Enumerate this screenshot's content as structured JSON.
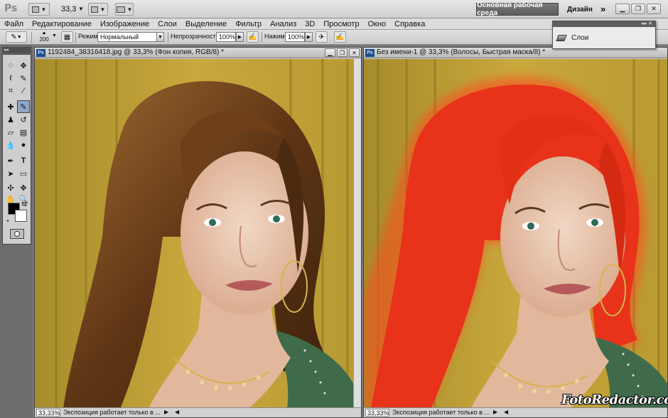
{
  "app": {
    "logo": "Ps",
    "zoom": "33,3",
    "workspace": "Основная рабочая среда",
    "design": "Дизайн",
    "more": "»"
  },
  "menu": [
    "Файл",
    "Редактирование",
    "Изображение",
    "Слои",
    "Выделение",
    "Фильтр",
    "Анализ",
    "3D",
    "Просмотр",
    "Окно",
    "Справка"
  ],
  "options": {
    "brush_size": "200",
    "mode_label": "Режим:",
    "mode_value": "Нормальный",
    "opacity_label": "Непрозрачность:",
    "opacity_value": "100%",
    "flow_label": "Нажим:",
    "flow_value": "100%"
  },
  "layers_panel": {
    "label": "Слои"
  },
  "documents": [
    {
      "badge": "Ps",
      "title": "1192484_38316418.jpg @ 33,3% (Фон копия, RGB/8) *",
      "zoom": "33,33%",
      "status": "Экспозиция работает только в ..."
    },
    {
      "badge": "Ps",
      "title": "Без имени-1 @ 33,3% (Волосы, Быстрая маска/8) *",
      "zoom": "33,33%",
      "status": "Экспозиция работает только в ..."
    }
  ],
  "watermark": "FotoRedactor.com",
  "colors": {
    "foreground": "#000000",
    "background": "#ffffff",
    "hair_left": "#6b3a16",
    "hair_right_mask": "#e8321a"
  }
}
